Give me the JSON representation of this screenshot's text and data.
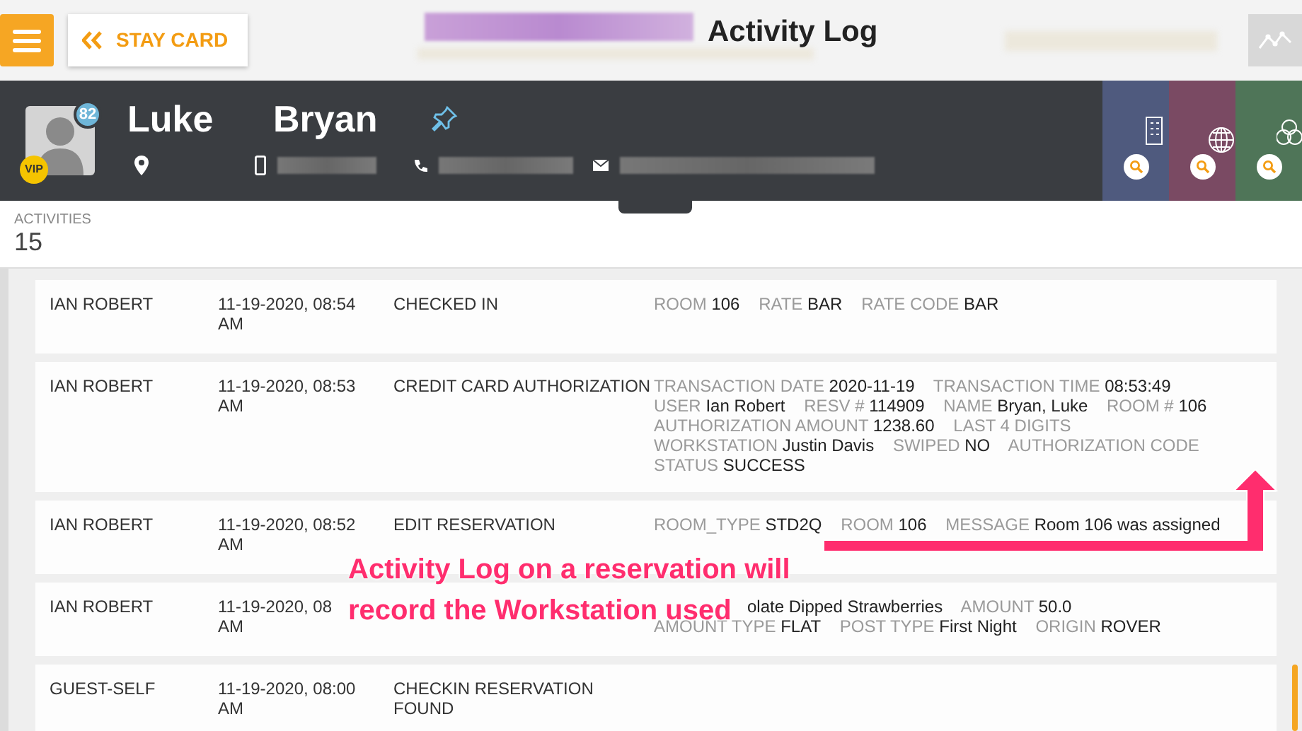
{
  "top_bar": {
    "back_button": {
      "label": "STAY CARD"
    },
    "title": "Activity Log"
  },
  "guest": {
    "first_name": "Luke",
    "last_name": "Bryan",
    "score_badge": "82",
    "vip_badge": "VIP"
  },
  "activities": {
    "label": "ACTIVITIES",
    "count": "15"
  },
  "rows": [
    {
      "user": "IAN ROBERT",
      "date": "11-19-2020, 08:54 AM",
      "action": "CHECKED IN",
      "details": [
        {
          "label": "ROOM",
          "value": "106"
        },
        {
          "label": "RATE",
          "value": "BAR"
        },
        {
          "label": "RATE CODE",
          "value": "BAR"
        }
      ]
    },
    {
      "user": "IAN ROBERT",
      "date": "11-19-2020, 08:53 AM",
      "action": "CREDIT CARD AUTHORIZATION",
      "details": [
        {
          "label": "TRANSACTION DATE",
          "value": "2020-11-19"
        },
        {
          "label": "TRANSACTION TIME",
          "value": "08:53:49"
        },
        {
          "label": "USER",
          "value": "Ian Robert"
        },
        {
          "label": "RESV #",
          "value": "114909"
        },
        {
          "label": "NAME",
          "value": "Bryan, Luke"
        },
        {
          "label": "ROOM #",
          "value": "106"
        },
        {
          "label": "AUTHORIZATION AMOUNT",
          "value": "1238.60"
        },
        {
          "label": "LAST 4 DIGITS"
        },
        {
          "label": "WORKSTATION",
          "value": "Justin Davis"
        },
        {
          "label": "SWIPED",
          "value": "NO"
        },
        {
          "label": "AUTHORIZATION CODE"
        },
        {
          "label": "STATUS",
          "value": "SUCCESS"
        }
      ]
    },
    {
      "user": "IAN ROBERT",
      "date": "11-19-2020, 08:52 AM",
      "action": "EDIT RESERVATION",
      "details": [
        {
          "label": "ROOM_TYPE",
          "value": "STD2Q"
        },
        {
          "label": "ROOM",
          "value": "106"
        },
        {
          "label": "MESSAGE",
          "value": "Room 106 was assigned"
        }
      ]
    },
    {
      "user": "IAN ROBERT",
      "date": "11-19-2020, 08 AM",
      "details": [
        {
          "value": "olate Dipped Strawberries"
        },
        {
          "label": "AMOUNT",
          "value": "50.0"
        },
        {
          "label": "AMOUNT TYPE",
          "value": "FLAT"
        },
        {
          "label": "POST TYPE",
          "value": "First Night"
        },
        {
          "label": "ORIGIN",
          "value": "ROVER"
        }
      ]
    },
    {
      "user": "GUEST-SELF",
      "date": "11-19-2020, 08:00 AM",
      "action": "CHECKIN RESERVATION FOUND"
    }
  ],
  "annotation": {
    "lines": [
      "Activity Log on a reservation will",
      "record the Workstation used"
    ]
  }
}
